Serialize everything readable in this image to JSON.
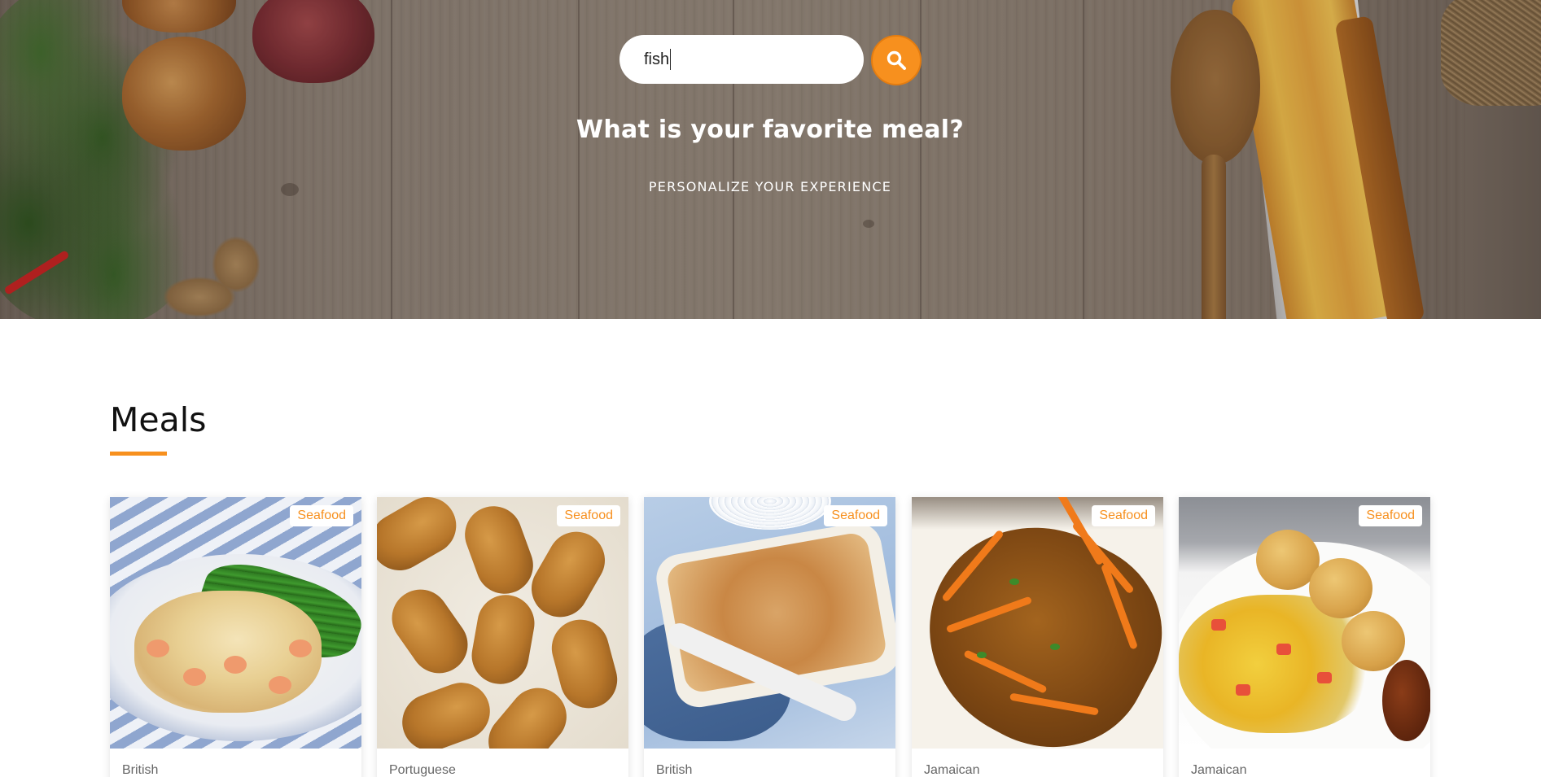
{
  "search": {
    "value": "fish",
    "placeholder": ""
  },
  "hero": {
    "title": "What is your favorite meal?",
    "subtitle": "PERSONALIZE YOUR EXPERIENCE"
  },
  "meals": {
    "heading": "Meals",
    "cards": [
      {
        "category": "Seafood",
        "area": "British"
      },
      {
        "category": "Seafood",
        "area": "Portuguese"
      },
      {
        "category": "Seafood",
        "area": "British"
      },
      {
        "category": "Seafood",
        "area": "Jamaican"
      },
      {
        "category": "Seafood",
        "area": "Jamaican"
      }
    ]
  },
  "colors": {
    "accent": "#f7901e",
    "text": "#111111"
  },
  "icons": {
    "search_button": "search-icon"
  }
}
